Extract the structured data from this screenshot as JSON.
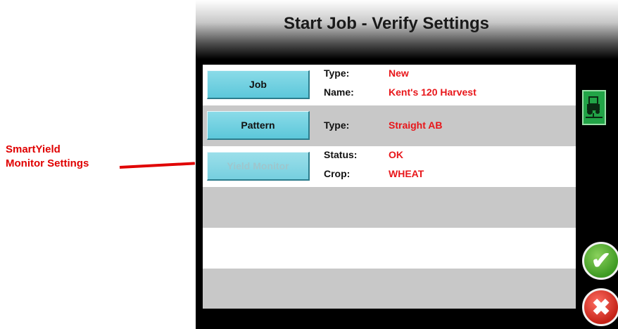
{
  "annotation": {
    "line1": "SmartYield",
    "line2": "Monitor Settings"
  },
  "screen": {
    "title": "Start Job - Verify Settings"
  },
  "job": {
    "button": "Job",
    "type_label": "Type:",
    "type_value": "New",
    "name_label": "Name:",
    "name_value": "Kent's 120 Harvest"
  },
  "pattern": {
    "button": "Pattern",
    "type_label": "Type:",
    "type_value": "Straight AB"
  },
  "yield_monitor": {
    "button": "Yield Monitor",
    "status_label": "Status:",
    "status_value": "OK",
    "crop_label": "Crop:",
    "crop_value": "WHEAT"
  },
  "icons": {
    "vehicle": "tractor-implement-icon",
    "confirm": "checkmark-icon",
    "cancel": "x-icon"
  },
  "colors": {
    "value_text": "#e8161a",
    "button": "#6ccfe0",
    "confirm": "#4caf2a",
    "cancel": "#d32a1f"
  }
}
